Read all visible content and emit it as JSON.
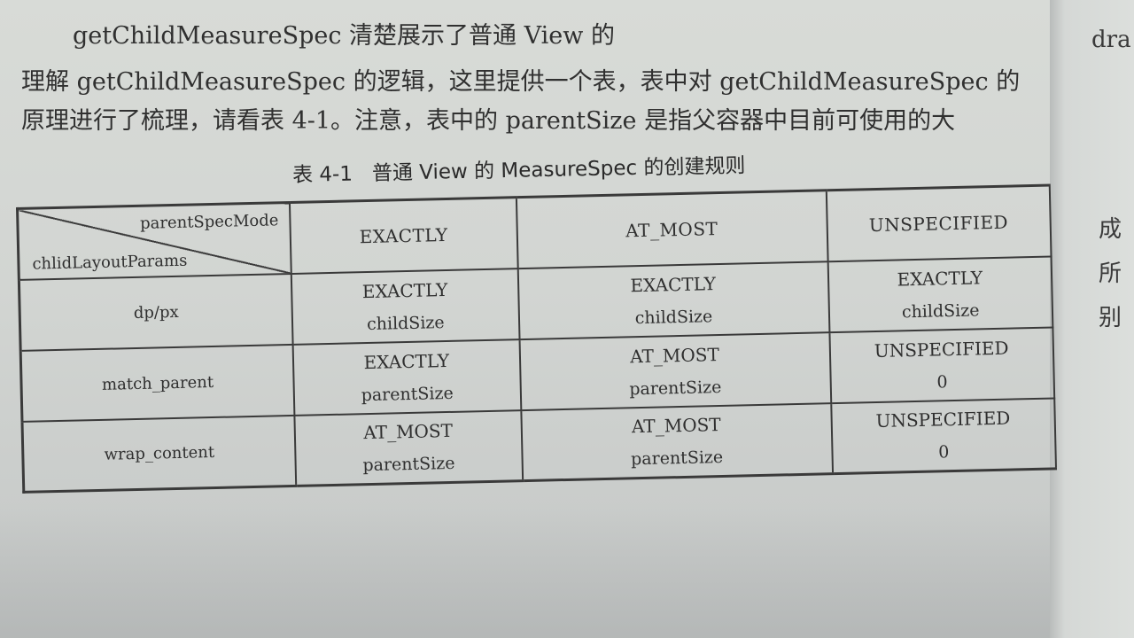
{
  "paragraph": {
    "line1": "getChildMeasureSpec 清楚展示了普通 View 的",
    "line2": "理解 getChildMeasureSpec 的逻辑，这里提供一个表，表中对 getChildMeasureSpec 的",
    "line3": "原理进行了梳理，请看表 4-1。注意，表中的 parentSize 是指父容器中目前可使用的大"
  },
  "margin": {
    "top_fragment": "dra",
    "right_fragments": [
      "成",
      "所",
      "别"
    ]
  },
  "table": {
    "caption_number": "表 4-1",
    "caption_title": "普通 View 的 MeasureSpec 的创建规则",
    "corner_top": "parentSpecMode",
    "corner_bottom": "chlidLayoutParams",
    "columns": [
      "EXACTLY",
      "AT_MOST",
      "UNSPECIFIED"
    ],
    "rows": [
      {
        "label": "dp/px",
        "cells": [
          {
            "mode": "EXACTLY",
            "size": "childSize"
          },
          {
            "mode": "EXACTLY",
            "size": "childSize"
          },
          {
            "mode": "EXACTLY",
            "size": "childSize"
          }
        ]
      },
      {
        "label": "match_parent",
        "cells": [
          {
            "mode": "EXACTLY",
            "size": "parentSize"
          },
          {
            "mode": "AT_MOST",
            "size": "parentSize"
          },
          {
            "mode": "UNSPECIFIED",
            "size": "0"
          }
        ]
      },
      {
        "label": "wrap_content",
        "cells": [
          {
            "mode": "AT_MOST",
            "size": "parentSize"
          },
          {
            "mode": "AT_MOST",
            "size": "parentSize"
          },
          {
            "mode": "UNSPECIFIED",
            "size": "0"
          }
        ]
      }
    ]
  }
}
